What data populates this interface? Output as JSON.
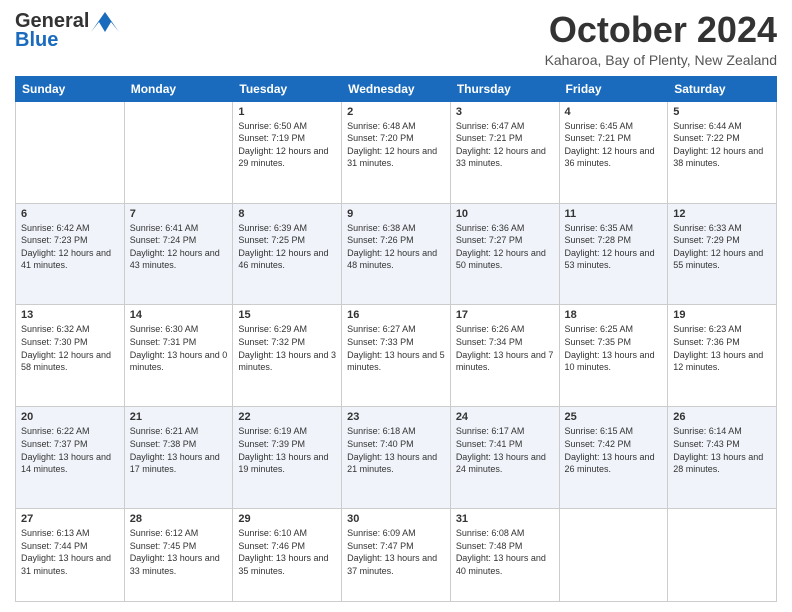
{
  "header": {
    "logo_line1": "General",
    "logo_line2": "Blue",
    "month": "October 2024",
    "location": "Kaharoa, Bay of Plenty, New Zealand"
  },
  "days_of_week": [
    "Sunday",
    "Monday",
    "Tuesday",
    "Wednesday",
    "Thursday",
    "Friday",
    "Saturday"
  ],
  "weeks": [
    [
      {
        "day": "",
        "info": ""
      },
      {
        "day": "",
        "info": ""
      },
      {
        "day": "1",
        "info": "Sunrise: 6:50 AM\nSunset: 7:19 PM\nDaylight: 12 hours and 29 minutes."
      },
      {
        "day": "2",
        "info": "Sunrise: 6:48 AM\nSunset: 7:20 PM\nDaylight: 12 hours and 31 minutes."
      },
      {
        "day": "3",
        "info": "Sunrise: 6:47 AM\nSunset: 7:21 PM\nDaylight: 12 hours and 33 minutes."
      },
      {
        "day": "4",
        "info": "Sunrise: 6:45 AM\nSunset: 7:21 PM\nDaylight: 12 hours and 36 minutes."
      },
      {
        "day": "5",
        "info": "Sunrise: 6:44 AM\nSunset: 7:22 PM\nDaylight: 12 hours and 38 minutes."
      }
    ],
    [
      {
        "day": "6",
        "info": "Sunrise: 6:42 AM\nSunset: 7:23 PM\nDaylight: 12 hours and 41 minutes."
      },
      {
        "day": "7",
        "info": "Sunrise: 6:41 AM\nSunset: 7:24 PM\nDaylight: 12 hours and 43 minutes."
      },
      {
        "day": "8",
        "info": "Sunrise: 6:39 AM\nSunset: 7:25 PM\nDaylight: 12 hours and 46 minutes."
      },
      {
        "day": "9",
        "info": "Sunrise: 6:38 AM\nSunset: 7:26 PM\nDaylight: 12 hours and 48 minutes."
      },
      {
        "day": "10",
        "info": "Sunrise: 6:36 AM\nSunset: 7:27 PM\nDaylight: 12 hours and 50 minutes."
      },
      {
        "day": "11",
        "info": "Sunrise: 6:35 AM\nSunset: 7:28 PM\nDaylight: 12 hours and 53 minutes."
      },
      {
        "day": "12",
        "info": "Sunrise: 6:33 AM\nSunset: 7:29 PM\nDaylight: 12 hours and 55 minutes."
      }
    ],
    [
      {
        "day": "13",
        "info": "Sunrise: 6:32 AM\nSunset: 7:30 PM\nDaylight: 12 hours and 58 minutes."
      },
      {
        "day": "14",
        "info": "Sunrise: 6:30 AM\nSunset: 7:31 PM\nDaylight: 13 hours and 0 minutes."
      },
      {
        "day": "15",
        "info": "Sunrise: 6:29 AM\nSunset: 7:32 PM\nDaylight: 13 hours and 3 minutes."
      },
      {
        "day": "16",
        "info": "Sunrise: 6:27 AM\nSunset: 7:33 PM\nDaylight: 13 hours and 5 minutes."
      },
      {
        "day": "17",
        "info": "Sunrise: 6:26 AM\nSunset: 7:34 PM\nDaylight: 13 hours and 7 minutes."
      },
      {
        "day": "18",
        "info": "Sunrise: 6:25 AM\nSunset: 7:35 PM\nDaylight: 13 hours and 10 minutes."
      },
      {
        "day": "19",
        "info": "Sunrise: 6:23 AM\nSunset: 7:36 PM\nDaylight: 13 hours and 12 minutes."
      }
    ],
    [
      {
        "day": "20",
        "info": "Sunrise: 6:22 AM\nSunset: 7:37 PM\nDaylight: 13 hours and 14 minutes."
      },
      {
        "day": "21",
        "info": "Sunrise: 6:21 AM\nSunset: 7:38 PM\nDaylight: 13 hours and 17 minutes."
      },
      {
        "day": "22",
        "info": "Sunrise: 6:19 AM\nSunset: 7:39 PM\nDaylight: 13 hours and 19 minutes."
      },
      {
        "day": "23",
        "info": "Sunrise: 6:18 AM\nSunset: 7:40 PM\nDaylight: 13 hours and 21 minutes."
      },
      {
        "day": "24",
        "info": "Sunrise: 6:17 AM\nSunset: 7:41 PM\nDaylight: 13 hours and 24 minutes."
      },
      {
        "day": "25",
        "info": "Sunrise: 6:15 AM\nSunset: 7:42 PM\nDaylight: 13 hours and 26 minutes."
      },
      {
        "day": "26",
        "info": "Sunrise: 6:14 AM\nSunset: 7:43 PM\nDaylight: 13 hours and 28 minutes."
      }
    ],
    [
      {
        "day": "27",
        "info": "Sunrise: 6:13 AM\nSunset: 7:44 PM\nDaylight: 13 hours and 31 minutes."
      },
      {
        "day": "28",
        "info": "Sunrise: 6:12 AM\nSunset: 7:45 PM\nDaylight: 13 hours and 33 minutes."
      },
      {
        "day": "29",
        "info": "Sunrise: 6:10 AM\nSunset: 7:46 PM\nDaylight: 13 hours and 35 minutes."
      },
      {
        "day": "30",
        "info": "Sunrise: 6:09 AM\nSunset: 7:47 PM\nDaylight: 13 hours and 37 minutes."
      },
      {
        "day": "31",
        "info": "Sunrise: 6:08 AM\nSunset: 7:48 PM\nDaylight: 13 hours and 40 minutes."
      },
      {
        "day": "",
        "info": ""
      },
      {
        "day": "",
        "info": ""
      }
    ]
  ]
}
